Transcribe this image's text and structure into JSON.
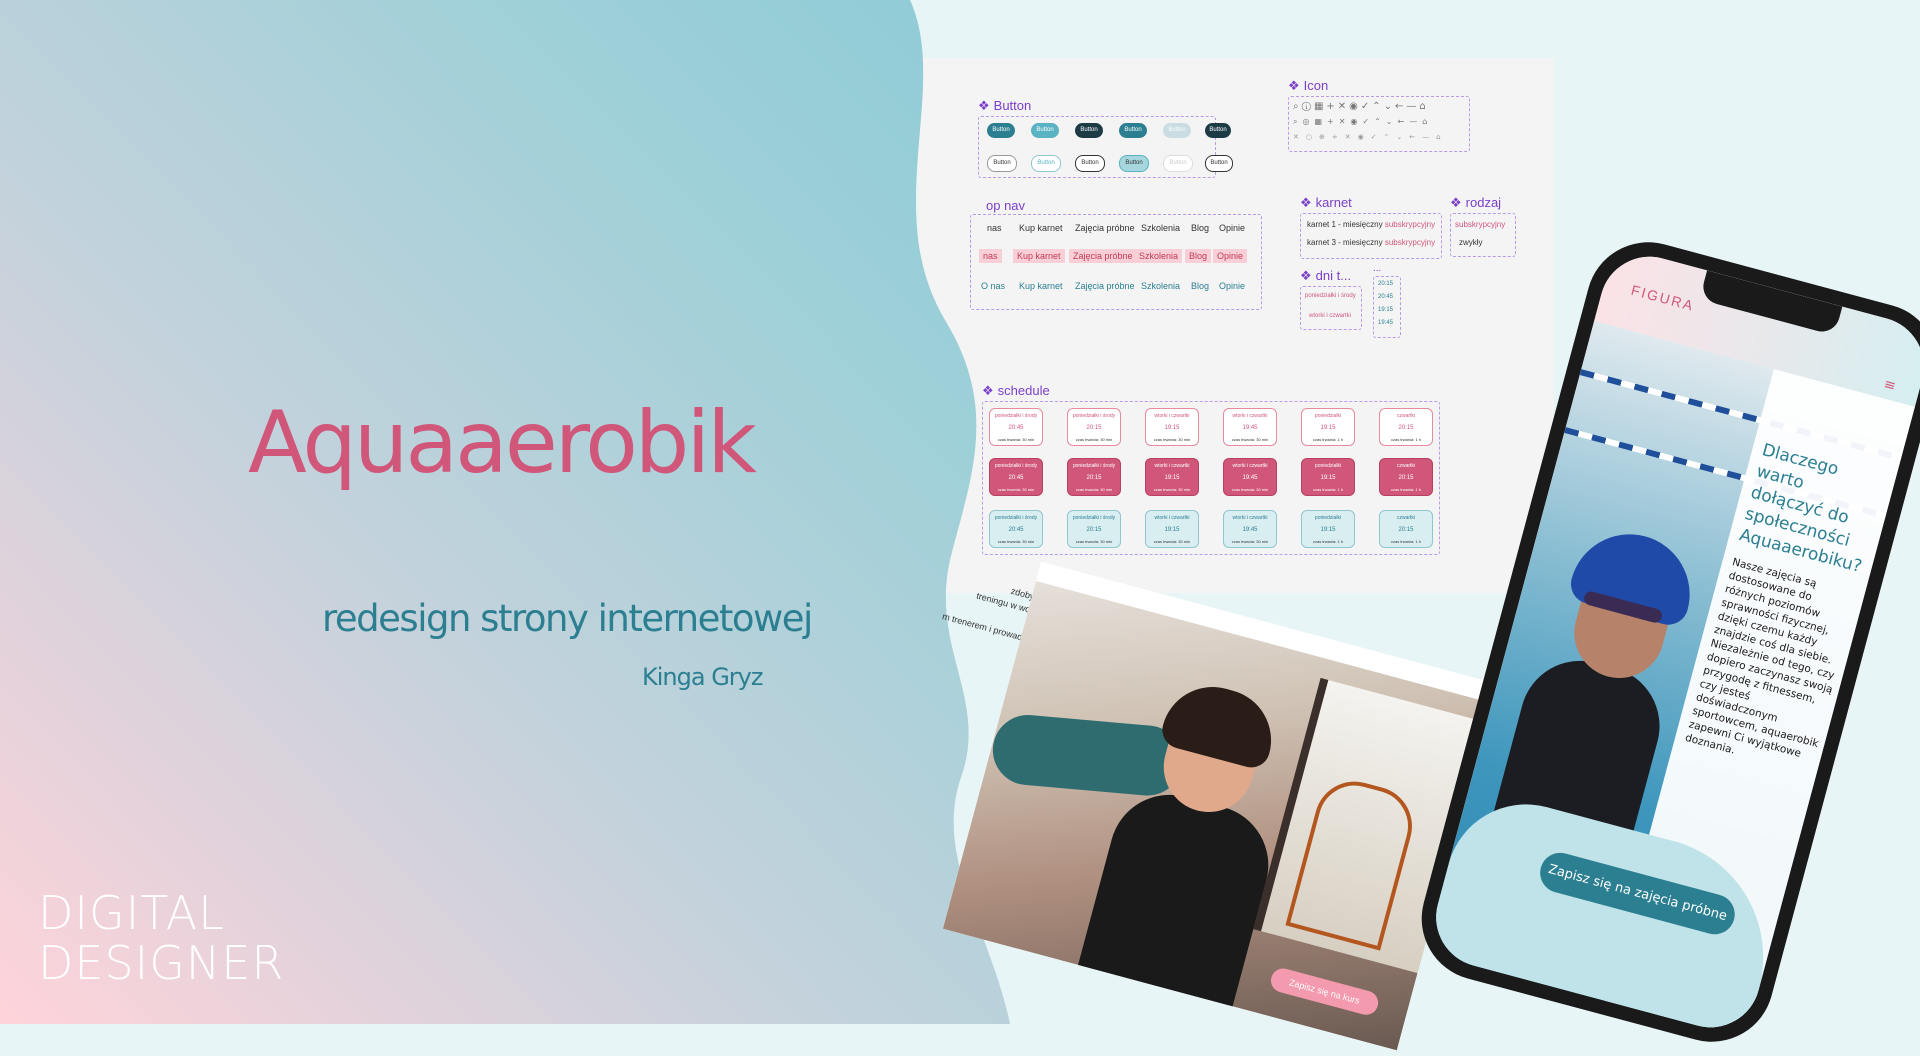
{
  "hero": {
    "title": "Aquaaerobik",
    "subtitle": "redesign strony internetowej",
    "author": "Kinga Gryz"
  },
  "logo": {
    "line1": "DIGITAL",
    "line2": "DESIGNER"
  },
  "board": {
    "button_label": "Button",
    "icon_label": "Icon",
    "topnav_label": "op nav",
    "karnet_label": "karnet",
    "rodzaj_label": "rodzaj",
    "dni_label": "dni t...",
    "schedule_label": "schedule",
    "mini_button_text": "Button",
    "nav_items": [
      "O nas",
      "Kup karnet",
      "Zajęcia próbne",
      "Szkolenia",
      "Blog",
      "Opinie"
    ],
    "nav_items_cut": [
      "nas",
      "Kup karnet",
      "Zajęcia próbne",
      "Szkolenia",
      "Blog",
      "Opinie"
    ],
    "nav_items_cut2": [
      "nas",
      "Kup karnet",
      "Zajęcia próbne",
      "Szkolenia",
      "Blog",
      "Opinie"
    ],
    "karnet_rows": [
      {
        "prefix": "karnet 1 - miesięczny",
        "accent": "subskrypcyjny"
      },
      {
        "prefix": "karnet 3 - miesięczny",
        "accent": "subskrypcyjny"
      }
    ],
    "rodzaj_rows": [
      "subskrypcyjny",
      "zwykły"
    ],
    "dni_rows": [
      "poniedziałki i środy",
      "wtorki i czwartki"
    ],
    "times": [
      "20:15",
      "20:45",
      "19:15",
      "19:45"
    ],
    "schedule": [
      {
        "day": "poniedziałki i środy",
        "time": "20:45",
        "len": "czas trwania: 30 min"
      },
      {
        "day": "poniedziałki i środy",
        "time": "20:15",
        "len": "czas trwania: 30 min"
      },
      {
        "day": "wtorki i czwartki",
        "time": "19:15",
        "len": "czas trwania: 30 min"
      },
      {
        "day": "wtorki i czwartki",
        "time": "19:45",
        "len": "czas trwania: 30 min"
      },
      {
        "day": "poniedziałki",
        "time": "19:15",
        "len": "czas trwania: 1 h"
      },
      {
        "day": "czwartki",
        "time": "20:15",
        "len": "czas trwania: 1 h"
      }
    ]
  },
  "photo_card": {
    "text1": "zdobyła szeroką",
    "text2": "treningu w wodzie, które",
    "text3": "m trenerem i prowadzącą szkolenia .",
    "cta": "Zapisz się na kurs"
  },
  "phone": {
    "brand": "FIGURA",
    "heading": "Dlaczego warto dołączyć do społeczności Aquaaerobiku?",
    "body": "Nasze zajęcia są dostosowane do różnych poziomów sprawności fizycznej, dzięki czemu każdy znajdzie coś dla siebie. Niezależnie od tego, czy dopiero zaczynasz swoją przygodę z fitnessem, czy jesteś doświadczonym sportowcem, aquaerobik zapewni Ci wyjątkowe doznania.",
    "cta": "Zapisz się na zajęcia próbne"
  },
  "colors": {
    "accent_pink": "#d0577a",
    "accent_teal": "#2b7f91",
    "component_purple": "#7b3fc9"
  }
}
